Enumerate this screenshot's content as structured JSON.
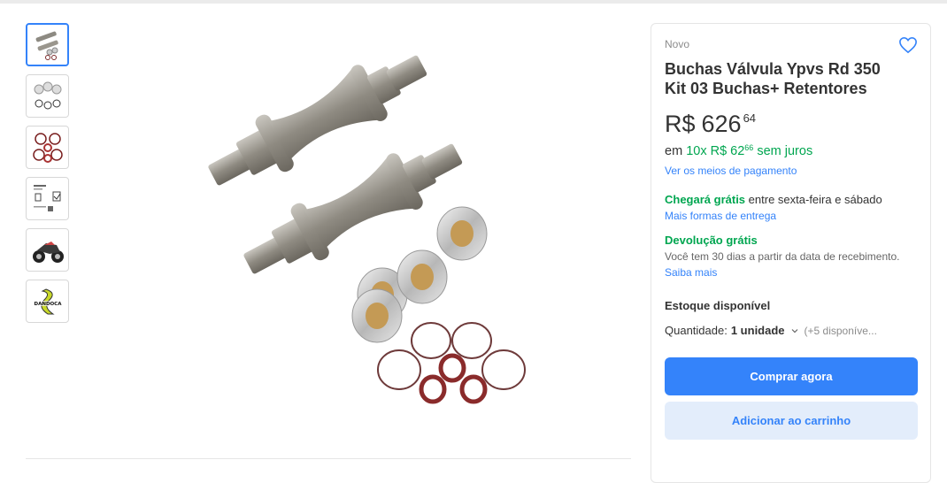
{
  "product": {
    "condition": "Novo",
    "title": "Buchas Válvula Ypvs Rd 350 Kit 03 Buchas+ Retentores",
    "price": {
      "currency": "R$",
      "amount": "626",
      "cents": "64"
    },
    "installments": {
      "prefix": "em",
      "text": "10x R$ 62",
      "cents": "66",
      "suffix": "sem juros"
    },
    "payment_link": "Ver os meios de pagamento"
  },
  "shipping": {
    "highlight": "Chegará grátis",
    "text": "entre sexta-feira e sábado",
    "link": "Mais formas de entrega"
  },
  "returns": {
    "title": "Devolução grátis",
    "description": "Você tem 30 dias a partir da data de recebimento.",
    "link": "Saiba mais"
  },
  "stock": {
    "title": "Estoque disponível",
    "quantity_label": "Quantidade:",
    "quantity_value": "1 unidade",
    "available": "(+5 disponíve..."
  },
  "actions": {
    "buy_now": "Comprar agora",
    "add_to_cart": "Adicionar ao carrinho"
  },
  "thumbnails": [
    "valves-thumb",
    "bushings-thumb",
    "seals-thumb",
    "diagram-thumb",
    "motorcycle-thumb",
    "brand-logo-thumb"
  ],
  "colors": {
    "accent": "#3483fa",
    "green": "#00a650",
    "secondary_bg": "#e3edfb"
  }
}
